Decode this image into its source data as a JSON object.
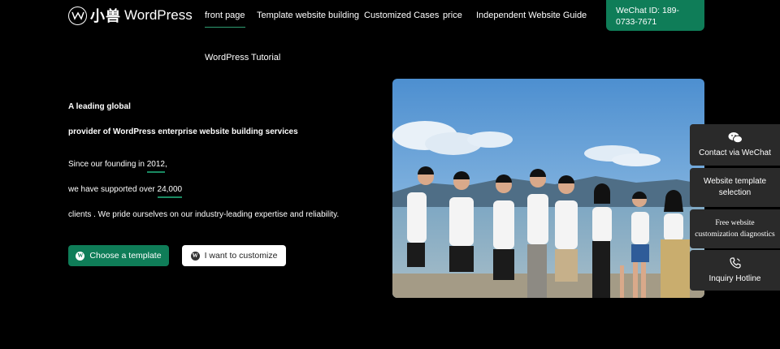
{
  "header": {
    "logo_cn": "小兽",
    "logo_en": "WordPress",
    "nav": [
      {
        "label": "front page",
        "active": true
      },
      {
        "label": "Template website building"
      },
      {
        "label": "Customized Cases"
      },
      {
        "label": "price"
      },
      {
        "label": "Independent Website Guide"
      },
      {
        "label": "WordPress Tutorial"
      }
    ],
    "wechat_label": "WeChat ID: 189-0733-7671"
  },
  "hero": {
    "heading_line1": "A leading global",
    "heading_line2": "provider of WordPress enterprise website building services",
    "para1_prefix": "Since our founding in ",
    "para1_year": "2012",
    "para1_suffix": ",",
    "para2_prefix": "we have supported over ",
    "para2_count": "24,000",
    "para3": "clients . We pride ourselves on our industry-leading expertise and reliability.",
    "btn_primary": "Choose a template",
    "btn_secondary": "I want to customize"
  },
  "side_panel": [
    {
      "label": "Contact via WeChat",
      "icon": "wechat-icon"
    },
    {
      "label": "Website template selection"
    },
    {
      "label": "Free website customization diagnostics"
    },
    {
      "label": "Inquiry Hotline",
      "icon": "phone-icon"
    }
  ],
  "colors": {
    "accent": "#0f7d58",
    "background": "#000000",
    "side_panel": "#2a2a2a"
  }
}
